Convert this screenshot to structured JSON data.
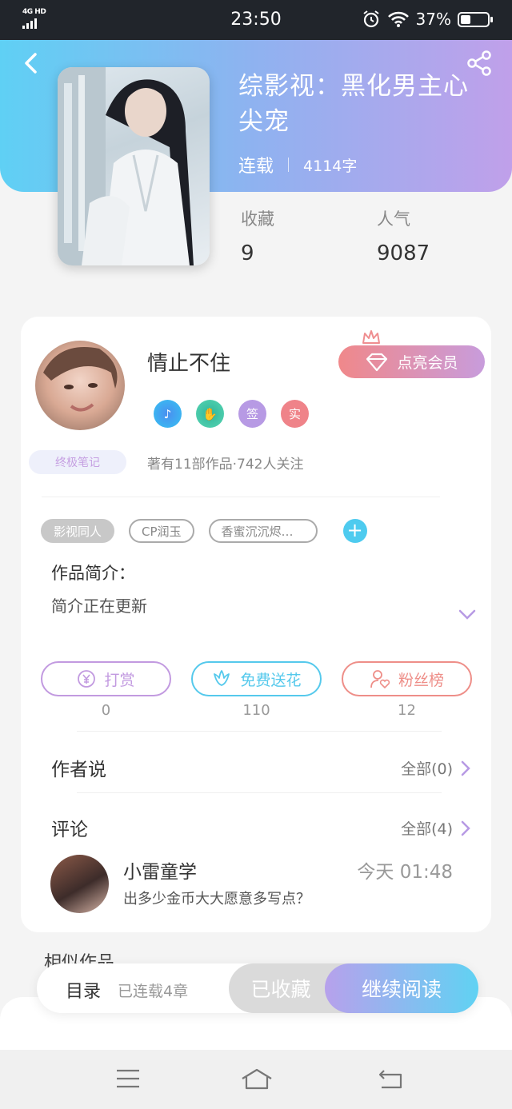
{
  "status_bar": {
    "network": "4G HD",
    "time": "23:50",
    "battery": "37%",
    "battery_level": 0.37,
    "icons": [
      "signal-icon",
      "alarm-icon",
      "wifi-icon",
      "battery-icon"
    ]
  },
  "header": {
    "title": "综影视：黑化男主心尖宠",
    "status": "连载",
    "word_count": "4114字",
    "stats": [
      {
        "label": "收藏",
        "value": "9"
      },
      {
        "label": "人气",
        "value": "9087"
      }
    ],
    "gradient": [
      "#5fd0f4",
      "#c0a0ea"
    ]
  },
  "author": {
    "name": "情止不住",
    "vip_button": "点亮会员",
    "badges": [
      "music-badge-icon",
      "handshake-badge-icon",
      "签",
      "实"
    ],
    "note_badge": "终极笔记",
    "info": "著有11部作品·742人关注"
  },
  "tags": [
    "影视同人",
    "CP润玉",
    "香蜜沉沉烬…"
  ],
  "intro": {
    "title": "作品简介：",
    "text": "简介正在更新"
  },
  "actions": [
    {
      "label": "打赏",
      "count": "0",
      "color": "#c29ae0"
    },
    {
      "label": "免费送花",
      "count": "110",
      "color": "#55c9ec"
    },
    {
      "label": "粉丝榜",
      "count": "12",
      "color": "#ee8e88"
    }
  ],
  "author_says": {
    "title": "作者说",
    "link": "全部(0)"
  },
  "comments": {
    "title": "评论",
    "link": "全部(4)",
    "items": [
      {
        "user": "小雷童学",
        "time": "今天 01:48",
        "text": "出多少金币大大愿意多写点？"
      }
    ]
  },
  "similar_title": "相似作品",
  "bottom_bar": {
    "toc_label": "目录",
    "toc_count": "已连载4章",
    "collected_button": "已收藏",
    "read_button": "继续阅读"
  },
  "nav": [
    "menu-icon",
    "home-icon",
    "back-icon"
  ]
}
